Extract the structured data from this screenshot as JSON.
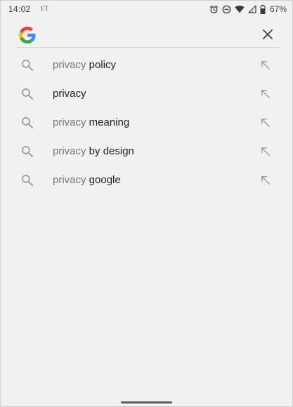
{
  "status_bar": {
    "time": "14:02",
    "carrier": "ET",
    "battery_percent": "67%",
    "icons": [
      "alarm-icon",
      "do-not-disturb-icon",
      "wifi-icon",
      "cell-signal-icon",
      "battery-icon"
    ]
  },
  "search": {
    "query": "",
    "logo": "google-g-logo",
    "clear_icon": "close-icon"
  },
  "suggestions": [
    {
      "prefix": "privacy",
      "completion": " policy"
    },
    {
      "prefix": "",
      "completion": "privacy"
    },
    {
      "prefix": "privacy",
      "completion": " meaning"
    },
    {
      "prefix": "privacy",
      "completion": " by design"
    },
    {
      "prefix": "privacy",
      "completion": " google"
    }
  ],
  "colors": {
    "background": "#f1f1f1",
    "text_primary": "#202124",
    "text_secondary": "#70757a",
    "icon_gray": "#9aa0a6",
    "google_blue": "#4285F4",
    "google_red": "#EA4335",
    "google_yellow": "#FBBC05",
    "google_green": "#34A853"
  }
}
